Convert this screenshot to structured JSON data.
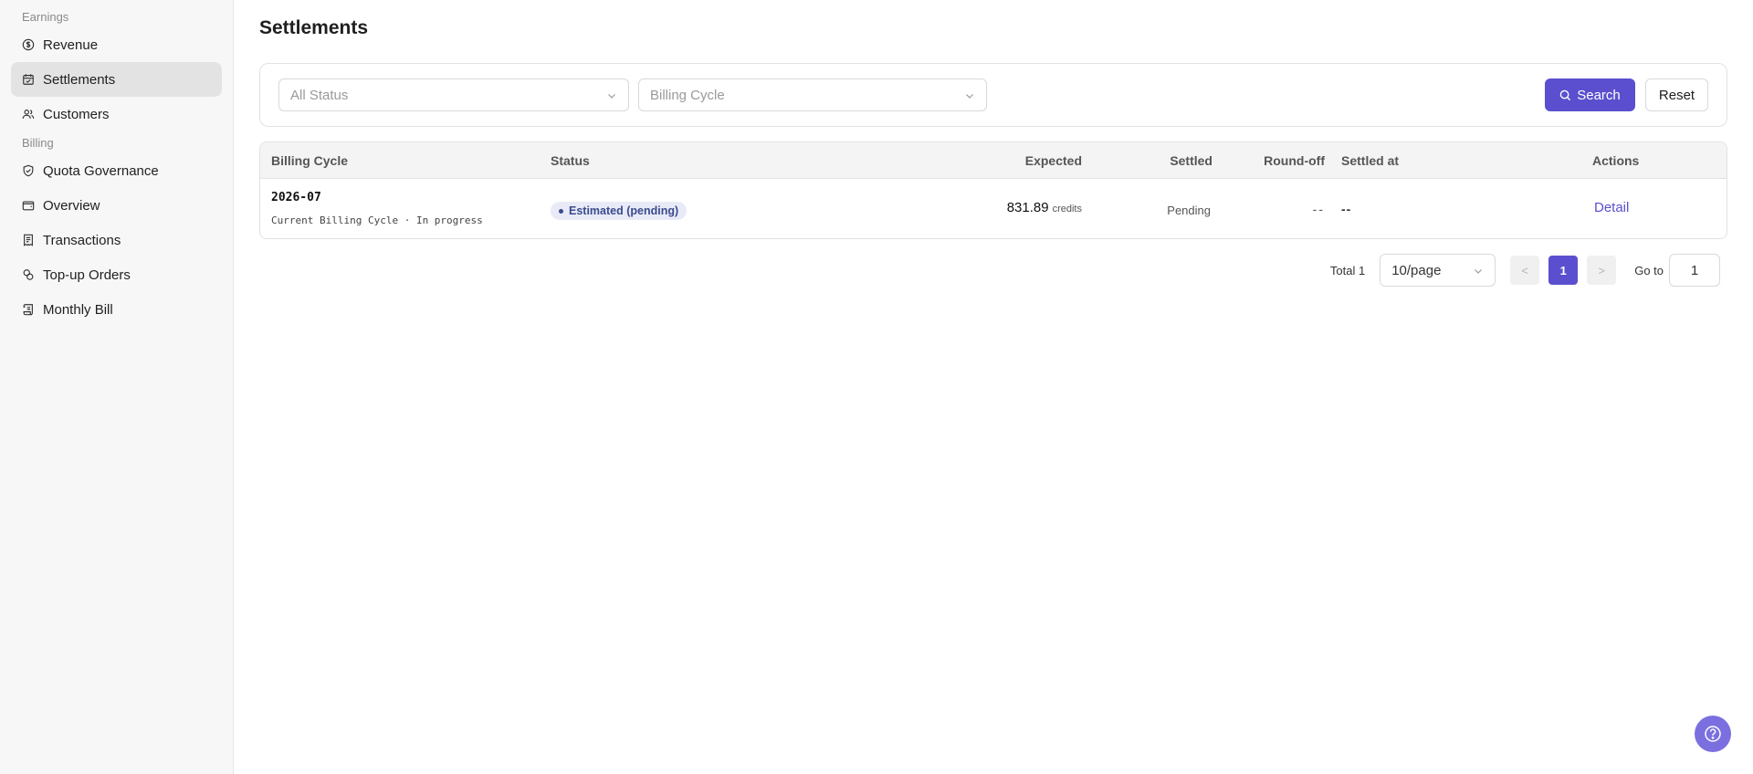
{
  "sidebar": {
    "sections": [
      {
        "label": "Earnings",
        "items": [
          {
            "label": "Revenue",
            "icon": "dollar-circle-icon",
            "active": false
          },
          {
            "label": "Settlements",
            "icon": "calendar-check-icon",
            "active": true
          },
          {
            "label": "Customers",
            "icon": "users-icon",
            "active": false
          }
        ]
      },
      {
        "label": "Billing",
        "items": [
          {
            "label": "Quota Governance",
            "icon": "shield-check-icon",
            "active": false
          },
          {
            "label": "Overview",
            "icon": "wallet-icon",
            "active": false
          },
          {
            "label": "Transactions",
            "icon": "receipt-icon",
            "active": false
          },
          {
            "label": "Top-up Orders",
            "icon": "coins-icon",
            "active": false
          },
          {
            "label": "Monthly Bill",
            "icon": "scroll-icon",
            "active": false
          }
        ]
      }
    ]
  },
  "page": {
    "title": "Settlements"
  },
  "filters": {
    "status_placeholder": "All Status",
    "cycle_placeholder": "Billing Cycle",
    "search_label": "Search",
    "reset_label": "Reset"
  },
  "table": {
    "columns": [
      "Billing Cycle",
      "Status",
      "Expected",
      "Settled",
      "Round-off",
      "Settled at",
      "Actions"
    ],
    "rows": [
      {
        "cycle": "2026-07",
        "cycle_sub": "Current Billing Cycle · In progress",
        "status": "Estimated (pending)",
        "expected": "831.89",
        "expected_unit": "credits",
        "settled": "Pending",
        "round_off": "--",
        "settled_at": "--",
        "action": "Detail"
      }
    ]
  },
  "pagination": {
    "total": "Total 1",
    "page_size": "10/page",
    "prev": "<",
    "current": "1",
    "next": ">",
    "goto_label": "Go to",
    "goto_value": "1"
  },
  "colors": {
    "accent": "#5b4fcf",
    "help": "#7b6fe0"
  }
}
